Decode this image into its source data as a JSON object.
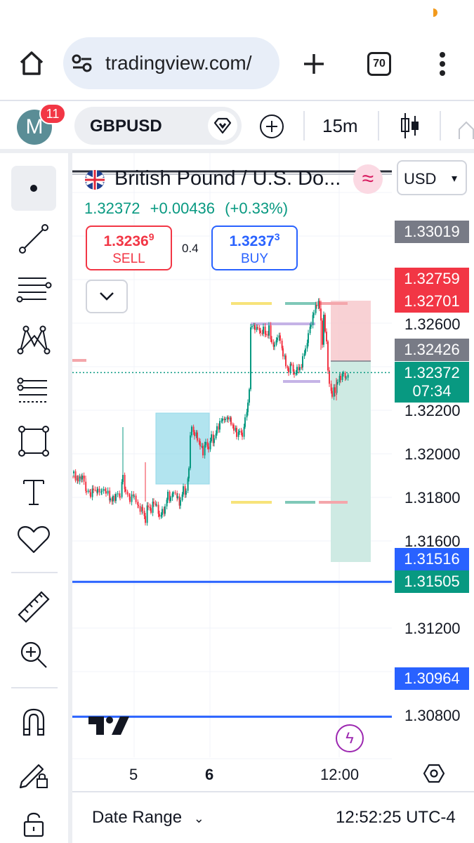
{
  "browser": {
    "url": "tradingview.com/",
    "tab_count": "70"
  },
  "header": {
    "avatar_letter": "M",
    "notification_count": "11",
    "symbol": "GBPUSD",
    "interval": "15m"
  },
  "legend": {
    "title": "British Pound / U.S. Do...",
    "last_price": "1.32372",
    "change": "+0.00436",
    "change_pct": "(+0.33%)",
    "currency": "USD"
  },
  "trade": {
    "sell_price": "1.3236",
    "sell_price_sup": "9",
    "sell_label": "SELL",
    "spread": "0.4",
    "buy_price": "1.3237",
    "buy_price_sup": "3",
    "buy_label": "BUY"
  },
  "price_tags": {
    "gray_top": "1.33019",
    "red_1": "1.32759",
    "red_2": "1.32701",
    "gray_mid": "1.32426",
    "current": "1.32372",
    "countdown": "07:34",
    "blue_1": "1.31516",
    "green_1": "1.31505",
    "blue_2": "1.30964"
  },
  "axis": {
    "price_labels": [
      "1.32600",
      "1.32200",
      "1.32000",
      "1.31800",
      "1.31600",
      "1.31200",
      "1.30800"
    ],
    "time_labels": [
      "5",
      "6",
      "12:00"
    ]
  },
  "bottom": {
    "date_range": "Date Range",
    "clock": "12:52:25 UTC-4"
  },
  "colors": {
    "up": "#089981",
    "down": "#f23645",
    "accent_blue": "#2962ff",
    "position_loss": "#f7c9cd",
    "position_profit": "#cbe9e2",
    "rectangle": "#7fd3e6"
  },
  "icons": {
    "left_toolbar": [
      "dot-icon",
      "trend-line-icon",
      "fib-icon",
      "pattern-icon",
      "forecast-icon",
      "rectangle-icon",
      "text-icon",
      "heart-icon",
      "ruler-icon",
      "zoom-in-icon",
      "magnet-icon",
      "lock-pencil-icon",
      "lock-icon"
    ]
  },
  "chart_data": {
    "type": "candlestick",
    "symbol": "GBPUSD",
    "interval": "15m",
    "ylim": [
      1.3066,
      1.3327
    ],
    "last_price": 1.32372,
    "horizontal_lines": [
      1.31516,
      1.30964
    ],
    "close_path": [
      [
        0,
        1.3196
      ],
      [
        6,
        1.3193
      ],
      [
        12,
        1.3194
      ],
      [
        18,
        1.319
      ],
      [
        24,
        1.3187
      ],
      [
        28,
        1.3189
      ],
      [
        34,
        1.3188
      ],
      [
        40,
        1.319
      ],
      [
        46,
        1.3188
      ],
      [
        52,
        1.3186
      ],
      [
        56,
        1.3185
      ],
      [
        60,
        1.3187
      ],
      [
        66,
        1.3188
      ],
      [
        70,
        1.3195
      ],
      [
        74,
        1.3189
      ],
      [
        80,
        1.3186
      ],
      [
        86,
        1.3186
      ],
      [
        92,
        1.3183
      ],
      [
        98,
        1.318
      ],
      [
        102,
        1.3177
      ],
      [
        106,
        1.3183
      ],
      [
        110,
        1.3181
      ],
      [
        114,
        1.3185
      ],
      [
        118,
        1.3183
      ],
      [
        122,
        1.3179
      ],
      [
        126,
        1.318
      ],
      [
        130,
        1.3182
      ],
      [
        134,
        1.3187
      ],
      [
        138,
        1.3185
      ],
      [
        142,
        1.3188
      ],
      [
        148,
        1.3186
      ],
      [
        152,
        1.3184
      ],
      [
        156,
        1.319
      ],
      [
        160,
        1.3187
      ],
      [
        164,
        1.3198
      ],
      [
        166,
        1.3212
      ],
      [
        168,
        1.3214
      ],
      [
        172,
        1.3212
      ],
      [
        176,
        1.321
      ],
      [
        180,
        1.3208
      ],
      [
        184,
        1.3205
      ],
      [
        188,
        1.3209
      ],
      [
        192,
        1.3207
      ],
      [
        196,
        1.3211
      ],
      [
        200,
        1.321
      ],
      [
        204,
        1.3214
      ],
      [
        208,
        1.3216
      ],
      [
        212,
        1.3218
      ],
      [
        216,
        1.3217
      ],
      [
        220,
        1.3219
      ],
      [
        224,
        1.3216
      ],
      [
        228,
        1.3215
      ],
      [
        232,
        1.3212
      ],
      [
        236,
        1.3214
      ],
      [
        240,
        1.3212
      ],
      [
        244,
        1.3218
      ],
      [
        248,
        1.3225
      ],
      [
        250,
        1.3231
      ],
      [
        252,
        1.3254
      ],
      [
        254,
        1.3258
      ],
      [
        258,
        1.3255
      ],
      [
        262,
        1.3257
      ],
      [
        266,
        1.3253
      ],
      [
        270,
        1.3256
      ],
      [
        274,
        1.3252
      ],
      [
        278,
        1.3255
      ],
      [
        282,
        1.3249
      ],
      [
        286,
        1.3247
      ],
      [
        290,
        1.3252
      ],
      [
        294,
        1.325
      ],
      [
        298,
        1.3245
      ],
      [
        302,
        1.3241
      ],
      [
        306,
        1.3238
      ],
      [
        310,
        1.3242
      ],
      [
        314,
        1.3236
      ],
      [
        318,
        1.324
      ],
      [
        322,
        1.3238
      ],
      [
        326,
        1.3243
      ],
      [
        330,
        1.3246
      ],
      [
        334,
        1.3252
      ],
      [
        338,
        1.3257
      ],
      [
        342,
        1.3261
      ],
      [
        346,
        1.3266
      ],
      [
        350,
        1.3264
      ],
      [
        352,
        1.3258
      ],
      [
        354,
        1.325
      ],
      [
        356,
        1.3259
      ],
      [
        358,
        1.3255
      ],
      [
        360,
        1.325
      ],
      [
        362,
        1.3238
      ],
      [
        364,
        1.3232
      ],
      [
        368,
        1.3228
      ],
      [
        372,
        1.323
      ],
      [
        376,
        1.3234
      ],
      [
        380,
        1.3236
      ],
      [
        384,
        1.3237
      ],
      [
        388,
        1.3236
      ],
      [
        392,
        1.3237
      ]
    ]
  }
}
